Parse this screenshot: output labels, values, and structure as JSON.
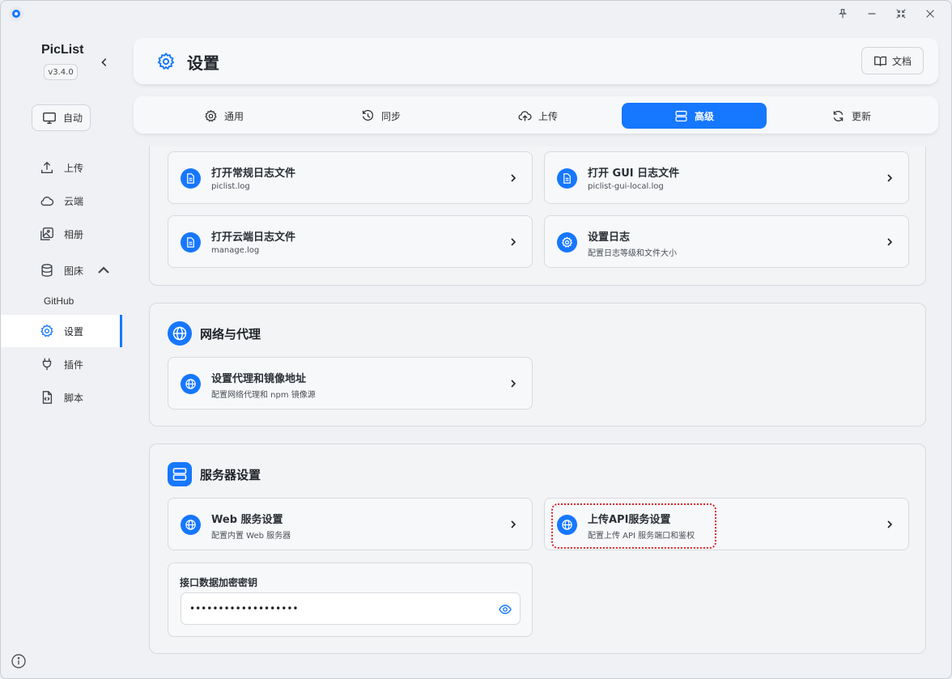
{
  "app": {
    "name": "PicList",
    "version": "v3.4.0"
  },
  "sidebar": {
    "auto_label": "自动",
    "items": [
      {
        "label": "上传",
        "icon": "upload-icon"
      },
      {
        "label": "云端",
        "icon": "cloud-icon"
      },
      {
        "label": "相册",
        "icon": "gallery-icon"
      },
      {
        "label": "图床",
        "icon": "database-icon"
      },
      {
        "label": "设置",
        "icon": "gear-icon"
      },
      {
        "label": "插件",
        "icon": "plug-icon"
      },
      {
        "label": "脚本",
        "icon": "script-icon"
      }
    ],
    "sub_item": "GitHub",
    "active": "设置"
  },
  "header": {
    "title": "设置",
    "doc_label": "文档"
  },
  "tabs": [
    {
      "label": "通用",
      "icon": "gear-icon"
    },
    {
      "label": "同步",
      "icon": "history-icon"
    },
    {
      "label": "上传",
      "icon": "cloud-upload-icon"
    },
    {
      "label": "高级",
      "icon": "server-icon",
      "active": true
    },
    {
      "label": "更新",
      "icon": "refresh-icon"
    }
  ],
  "logs": {
    "items": [
      {
        "title": "打开常规日志文件",
        "sub": "piclist.log"
      },
      {
        "title": "打开 GUI 日志文件",
        "sub": "piclist-gui-local.log"
      },
      {
        "title": "打开云端日志文件",
        "sub": "manage.log"
      },
      {
        "title": "设置日志",
        "sub": "配置日志等级和文件大小"
      }
    ]
  },
  "network": {
    "title": "网络与代理",
    "items": [
      {
        "title": "设置代理和镜像地址",
        "sub": "配置网络代理和 npm 镜像源"
      }
    ]
  },
  "server": {
    "title": "服务器设置",
    "items": [
      {
        "title": "Web 服务设置",
        "sub": "配置内置 Web 服务器"
      },
      {
        "title": "上传API服务设置",
        "sub": "配置上传 API 服务端口和鉴权"
      }
    ],
    "key_label": "接口数据加密密钥",
    "key_value": "•••••••••••••••••••"
  },
  "colors": {
    "accent": "#1677ff",
    "highlight": "#d9262a"
  }
}
